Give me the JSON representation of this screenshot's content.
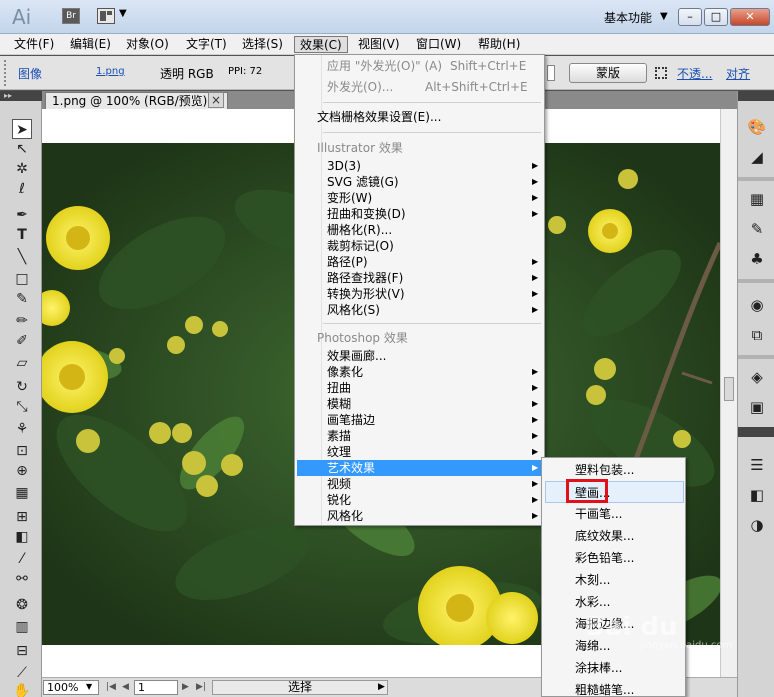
{
  "app": {
    "logo": "Ai",
    "bridge_label": "Br",
    "workspace": "基本功能"
  },
  "menubar": [
    "文件(F)",
    "编辑(E)",
    "对象(O)",
    "文字(T)",
    "选择(S)",
    "效果(C)",
    "视图(V)",
    "窗口(W)",
    "帮助(H)"
  ],
  "controlbar": {
    "type": "图像",
    "file": "1.png",
    "mode": "透明 RGB",
    "ppi": "PPI: 72",
    "mask": "蒙版",
    "opacity": "不透...",
    "align": "对齐"
  },
  "document": {
    "tab": "1.png @ 100% (RGB/预览)",
    "close": "×"
  },
  "statusbar": {
    "zoom": "100%",
    "page": "1",
    "tool": "选择"
  },
  "effect_menu": {
    "apply_last": "应用 \"外发光(O)\"  (A)",
    "apply_last_shortcut": "Shift+Ctrl+E",
    "last_effect": "外发光(O)...",
    "last_effect_shortcut": "Alt+Shift+Ctrl+E",
    "raster_settings": "文档栅格效果设置(E)...",
    "illustrator_header": "Illustrator 效果",
    "illustrator_items": [
      {
        "label": "3D(3)",
        "sub": true
      },
      {
        "label": "SVG 滤镜(G)",
        "sub": true
      },
      {
        "label": "变形(W)",
        "sub": true
      },
      {
        "label": "扭曲和变换(D)",
        "sub": true
      },
      {
        "label": "栅格化(R)...",
        "sub": false
      },
      {
        "label": "裁剪标记(O)",
        "sub": false
      },
      {
        "label": "路径(P)",
        "sub": true
      },
      {
        "label": "路径查找器(F)",
        "sub": true
      },
      {
        "label": "转换为形状(V)",
        "sub": true
      },
      {
        "label": "风格化(S)",
        "sub": true
      }
    ],
    "photoshop_header": "Photoshop 效果",
    "photoshop_items": [
      {
        "label": "效果画廊...",
        "sub": false
      },
      {
        "label": "像素化",
        "sub": true
      },
      {
        "label": "扭曲",
        "sub": true
      },
      {
        "label": "模糊",
        "sub": true
      },
      {
        "label": "画笔描边",
        "sub": true
      },
      {
        "label": "素描",
        "sub": true
      },
      {
        "label": "纹理",
        "sub": true
      },
      {
        "label": "艺术效果",
        "sub": true,
        "highlighted": true
      },
      {
        "label": "视频",
        "sub": true
      },
      {
        "label": "锐化",
        "sub": true
      },
      {
        "label": "风格化",
        "sub": true
      }
    ]
  },
  "art_submenu": [
    "塑料包装...",
    "壁画...",
    "干画笔...",
    "底纹效果...",
    "彩色铅笔...",
    "木刻...",
    "水彩...",
    "海报边缘...",
    "海绵...",
    "涂抹棒...",
    "粗糙蜡笔..."
  ],
  "watermark": {
    "text": "Bai du",
    "sub": "jingyan.baidu.com"
  },
  "colors": {
    "menu_highlight": "#3399ff",
    "callout": "#e0111b",
    "link": "#1a4fb2"
  }
}
